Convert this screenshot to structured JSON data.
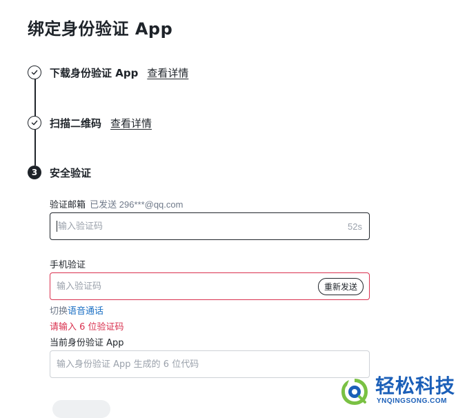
{
  "page": {
    "title": "绑定身份验证 App"
  },
  "steps": [
    {
      "title": "下载身份验证 App",
      "link": "查看详情",
      "status": "done"
    },
    {
      "title": "扫描二维码",
      "link": "查看详情",
      "status": "done"
    },
    {
      "number": "3",
      "title": "安全验证",
      "status": "active"
    }
  ],
  "email_verify": {
    "label": "验证邮箱",
    "sent_text": "已发送 296***@qq.com",
    "placeholder": "输入验证码",
    "countdown": "52s"
  },
  "phone_verify": {
    "label": "手机验证",
    "placeholder": "输入验证码",
    "resend_label": "重新发送",
    "switch_prefix": "切换",
    "switch_link": "语音通话",
    "error": "请输入 6 位验证码"
  },
  "authenticator": {
    "label": "当前身份验证 App",
    "placeholder": "输入身份验证 App 生成的 6 位代码"
  },
  "watermark": {
    "name": "轻松科技",
    "sub": "YNQINGSONG.COM"
  },
  "colors": {
    "text": "#1e2329",
    "muted": "#707a8a",
    "error": "#d9304e",
    "link": "#1a6fc4",
    "watermark_blue": "#1b5fb8",
    "watermark_green": "#7ac143"
  },
  "icons": {
    "step_done": "check-icon"
  }
}
